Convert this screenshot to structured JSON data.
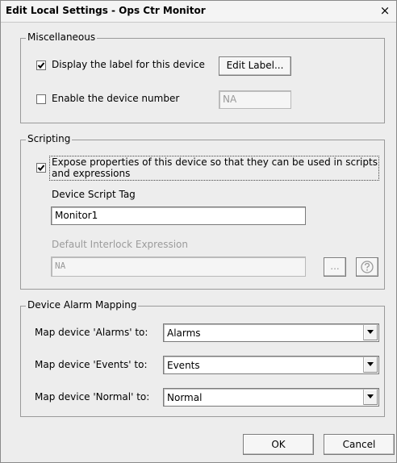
{
  "window": {
    "title": "Edit Local Settings - Ops Ctr Monitor",
    "close_glyph": "×"
  },
  "misc": {
    "legend": "Miscellaneous",
    "display_label": {
      "label": "Display the label for this device",
      "checked": true
    },
    "edit_label_button": "Edit Label...",
    "enable_number": {
      "label": "Enable the device number",
      "checked": false
    },
    "device_number_value": "NA"
  },
  "scripting": {
    "legend": "Scripting",
    "expose": {
      "label_line1": "Expose properties of this device so that they can be used in scripts",
      "label_line2": "and expressions",
      "checked": true
    },
    "script_tag_label": "Device Script Tag",
    "script_tag_value": "Monitor1",
    "interlock_label": "Default Interlock Expression",
    "interlock_value": "NA",
    "browse_button": "...",
    "help_icon": "question-circle-icon"
  },
  "alarm_mapping": {
    "legend": "Device Alarm Mapping",
    "rows": [
      {
        "label": "Map device 'Alarms' to:",
        "value": "Alarms"
      },
      {
        "label": "Map device 'Events' to:",
        "value": "Events"
      },
      {
        "label": "Map device 'Normal' to:",
        "value": "Normal"
      }
    ]
  },
  "footer": {
    "ok": "OK",
    "cancel": "Cancel"
  }
}
